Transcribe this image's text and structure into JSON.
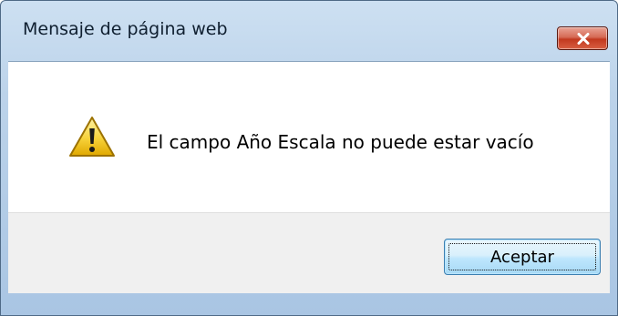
{
  "window": {
    "title": "Mensaje de página web",
    "frame_color": "#a9c5e3",
    "close_icon": "close-icon"
  },
  "dialog": {
    "icon": "warning-icon",
    "message": "El campo Año Escala no puede estar vacío"
  },
  "buttons": {
    "ok_label": "Aceptar"
  }
}
